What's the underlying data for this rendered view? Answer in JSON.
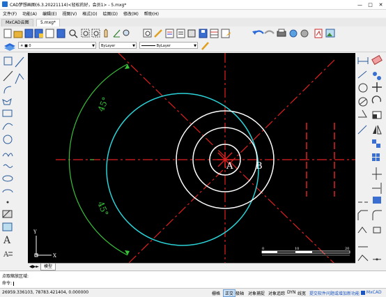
{
  "window": {
    "title": "CAD梦想画图(6.3.20221114)<轻松的好，会员1> - 5.mxg*",
    "controls": [
      "minimize",
      "maximize",
      "close"
    ]
  },
  "menu": [
    "文件(F)",
    "功能(A)",
    "编辑(E)",
    "视图(V)",
    "格式(O)",
    "绘图(D)",
    "修改(M)",
    "帮助(H)"
  ],
  "tabs": [
    {
      "label": "MxCAD云图",
      "active": false
    },
    {
      "label": "5.mxg*",
      "active": true
    }
  ],
  "layer_bar": {
    "layer_value": "0",
    "color_value": "ByLayer",
    "linetype_value": "ByLayer"
  },
  "drawing": {
    "label_a": "A",
    "label_b": "B",
    "angle_top": "45°",
    "angle_bottom": "45°",
    "ucs_x": "X",
    "ucs_y": "Y",
    "scale_left": "0",
    "scale_mid": "10",
    "scale_right": "20",
    "colors": {
      "circle_cyan": "#2bd3d8",
      "circle_white": "#ffffff",
      "centerline": "#e02020",
      "dim": "#3ac13a"
    }
  },
  "layout_tab": "模型",
  "command": {
    "history": "点取缩放区域:",
    "prompt": "命令:"
  },
  "status": {
    "coordinates": "26959.336103,  78783.421404,  0.000000",
    "toggles": [
      "栅格",
      "正交",
      "极轴",
      "对象捕捉",
      "对象追踪",
      "DYN",
      "线宽"
    ],
    "active_toggle": "正交",
    "notice": "提交软件问题或增加新功能",
    "brand": "MxCAD"
  }
}
